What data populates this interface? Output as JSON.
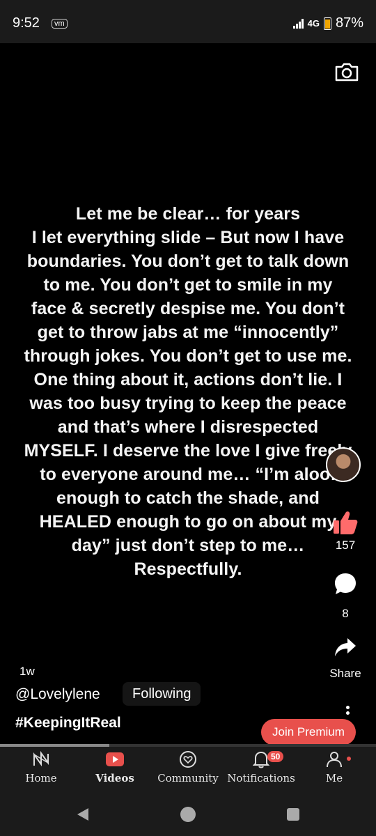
{
  "status": {
    "time": "9:52",
    "app_icon": "vm",
    "network": "4G",
    "battery": "87%"
  },
  "post": {
    "lines": [
      "Let me be clear… for years",
      "I let everything slide – But now I have",
      "boundaries. You don’t get to talk down",
      "to me. You don’t get to smile in my",
      "face & secretly despise me. You don’t",
      "get to throw jabs at me “innocently”",
      "through jokes. You don’t get to use me.",
      "One thing about it, actions don’t lie. I",
      "was too busy trying to keep the peace",
      "and that’s where I disrespected",
      "MYSELF. I deserve the love I give freely",
      "to everyone around me… “I’m aloof",
      "enough to catch the shade, and",
      "HEALED enough to go on about my",
      "day” just don’t step to me…",
      "Respectfully."
    ],
    "time_ago": "1w",
    "handle": "@Lovelylene",
    "follow_label": "Following",
    "hashtag": "#KeepingItReal"
  },
  "actions": {
    "likes": "157",
    "comments": "8",
    "share_label": "Share"
  },
  "premium_label": "Join Premium",
  "progress": 0.29,
  "tabs": [
    {
      "label": "Home",
      "icon": "home-logo-icon"
    },
    {
      "label": "Videos",
      "icon": "play-icon"
    },
    {
      "label": "Community",
      "icon": "community-heart-icon"
    },
    {
      "label": "Notifications",
      "icon": "bell-icon",
      "badge": "50"
    },
    {
      "label": "Me",
      "icon": "person-icon"
    }
  ],
  "colors": {
    "accent": "#e8504c",
    "like": "#ff6b6b",
    "bar": "#1b1b1b"
  }
}
